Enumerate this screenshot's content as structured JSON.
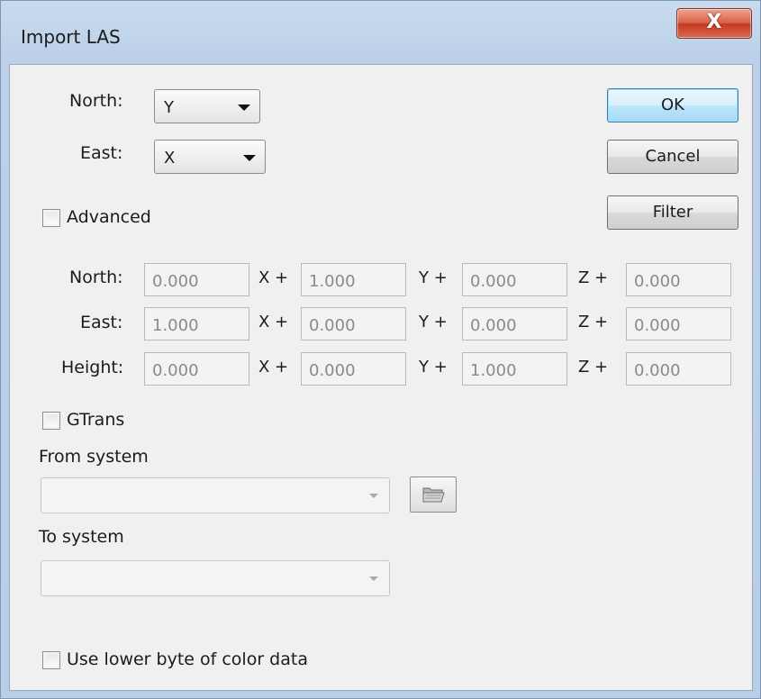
{
  "window": {
    "title": "Import LAS",
    "close_glyph": "X"
  },
  "axis_select": {
    "north_label": "North:",
    "north_value": "Y",
    "east_label": "East:",
    "east_value": "X"
  },
  "buttons": {
    "ok": "OK",
    "cancel": "Cancel",
    "filter": "Filter"
  },
  "advanced": {
    "label": "Advanced",
    "checked": false,
    "rows": [
      {
        "label": "North:",
        "c0": "0.000",
        "op0": "X +",
        "c1": "1.000",
        "op1": "Y +",
        "c2": "0.000",
        "op2": "Z +",
        "c3": "0.000"
      },
      {
        "label": "East:",
        "c0": "1.000",
        "op0": "X +",
        "c1": "0.000",
        "op1": "Y +",
        "c2": "0.000",
        "op2": "Z +",
        "c3": "0.000"
      },
      {
        "label": "Height:",
        "c0": "0.000",
        "op0": "X +",
        "c1": "0.000",
        "op1": "Y +",
        "c2": "1.000",
        "op2": "Z +",
        "c3": "0.000"
      }
    ]
  },
  "gtrans": {
    "label": "GTrans",
    "checked": false,
    "from_label": "From system",
    "to_label": "To system",
    "browse_icon": "folder-browse-icon"
  },
  "color": {
    "label": "Use lower byte of color data",
    "checked": false
  },
  "colors": {
    "default_button_border": "#3c7fb1",
    "close_button": "#c5391f",
    "dialog_bg": "#f0f0f0"
  }
}
